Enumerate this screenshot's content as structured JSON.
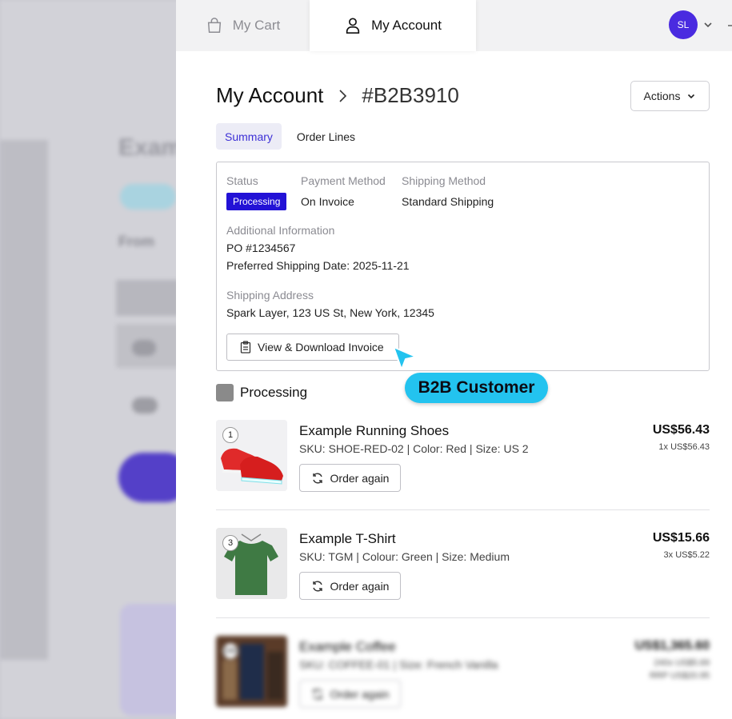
{
  "topbar": {
    "cart_tab": "My Cart",
    "account_tab": "My Account",
    "avatar_initials": "SL"
  },
  "header": {
    "breadcrumb_root": "My Account",
    "order_id": "#B2B3910",
    "actions_label": "Actions"
  },
  "subtabs": [
    "Summary",
    "Order Lines"
  ],
  "summary": {
    "status_label": "Status",
    "status_value": "Processing",
    "payment_label": "Payment Method",
    "payment_value": "On Invoice",
    "shipping_label": "Shipping Method",
    "shipping_value": "Standard Shipping",
    "additional_label": "Additional Information",
    "po": "PO #1234567",
    "preferred_date": "Preferred Shipping Date: 2025-11-21",
    "address_label": "Shipping Address",
    "address": "Spark Layer, 123 US St, New York, 12345",
    "invoice_button": "View & Download Invoice"
  },
  "callout": "B2B Customer",
  "group_title": "Processing",
  "items": [
    {
      "qty": "1",
      "name": "Example Running Shoes",
      "sku": "SKU: SHOE-RED-02 | Color: Red | Size: US 2",
      "total": "US$56.43",
      "unit": "1x US$56.43",
      "reorder": "Order again"
    },
    {
      "qty": "3",
      "name": "Example T-Shirt",
      "sku": "SKU: TGM | Colour: Green | Size: Medium",
      "total": "US$15.66",
      "unit": "3x US$5.22",
      "reorder": "Order again"
    },
    {
      "qty": "240",
      "name": "Example Coffee",
      "sku": "SKU: COFFEE-01 | Size: French Vanilla",
      "total": "US$1,365.60",
      "unit": "240x US$5.69",
      "unit_extra": "RRP US$20.95",
      "reorder": "Order again"
    }
  ],
  "colors": {
    "accent": "#2312d6",
    "avatar": "#4a2be0",
    "callout": "#23c3ef"
  }
}
